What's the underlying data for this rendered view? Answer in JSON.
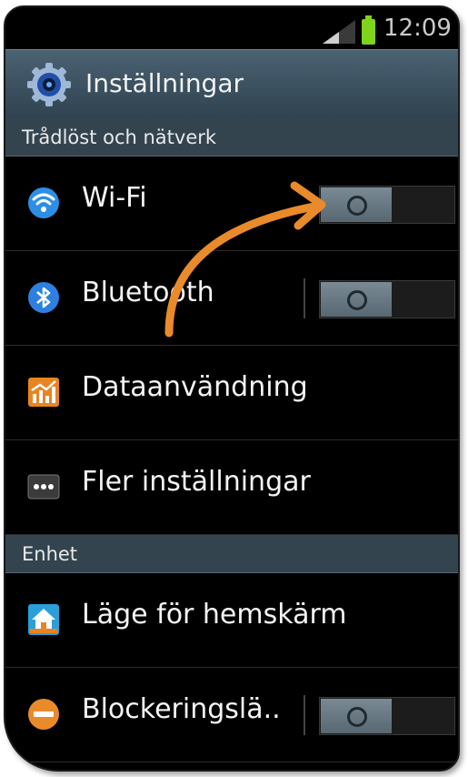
{
  "status_bar": {
    "time": "12:09"
  },
  "header": {
    "title": "Inställningar",
    "icon": "settings-gear-icon"
  },
  "sections": [
    {
      "label": "Trådlöst och nätverk"
    },
    {
      "label": "Enhet"
    }
  ],
  "items": [
    {
      "label": "Wi-Fi",
      "icon": "wifi-icon",
      "toggle": "off"
    },
    {
      "label": "Bluetooth",
      "icon": "bluetooth-icon",
      "toggle": "off"
    },
    {
      "label": "Dataanvändning",
      "icon": "data-usage-icon"
    },
    {
      "label": "Fler inställningar",
      "icon": "more-settings-icon"
    },
    {
      "label": "Läge för hemskärm",
      "icon": "home-screen-icon"
    },
    {
      "label": "Blockeringslä..",
      "icon": "blocking-mode-icon",
      "toggle": "off"
    }
  ],
  "colors": {
    "header_bg": "#3b5060",
    "section_bg": "#33444f",
    "arrow": "#e98a2b",
    "battery": "#7ed31b"
  }
}
